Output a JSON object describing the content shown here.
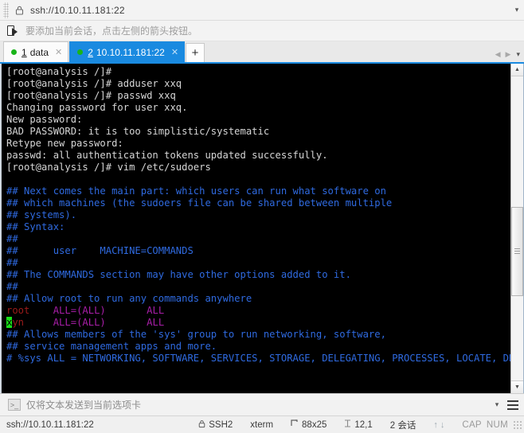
{
  "window": {
    "url_bar": {
      "lock_icon": "lock-icon",
      "value": "ssh://10.10.11.181:22",
      "dropdown_icon": "▾"
    },
    "hint_bar": {
      "icon": "add-session-icon",
      "text": "要添加当前会话，点击左侧的箭头按钮。"
    }
  },
  "tabs": {
    "items": [
      {
        "num": "1",
        "label": "data",
        "close": "✕",
        "active": false
      },
      {
        "num": "2",
        "label": "10.10.11.181:22",
        "close": "✕",
        "active": true
      }
    ],
    "new_tab_label": "+",
    "nav_prev": "◀",
    "nav_next": "▶",
    "list_caret": "▾"
  },
  "terminal": {
    "lines": [
      {
        "segments": [
          {
            "text": "[root@analysis /]#",
            "color": "white"
          }
        ]
      },
      {
        "segments": [
          {
            "text": "[root@analysis /]# adduser xxq",
            "color": "white"
          }
        ]
      },
      {
        "segments": [
          {
            "text": "[root@analysis /]# passwd xxq",
            "color": "white"
          }
        ]
      },
      {
        "segments": [
          {
            "text": "Changing password for user xxq.",
            "color": "white"
          }
        ]
      },
      {
        "segments": [
          {
            "text": "New password:",
            "color": "white"
          }
        ]
      },
      {
        "segments": [
          {
            "text": "BAD PASSWORD: it is too simplistic/systematic",
            "color": "white"
          }
        ]
      },
      {
        "segments": [
          {
            "text": "Retype new password:",
            "color": "white"
          }
        ]
      },
      {
        "segments": [
          {
            "text": "passwd: all authentication tokens updated successfully.",
            "color": "white"
          }
        ]
      },
      {
        "segments": [
          {
            "text": "[root@analysis /]# vim /etc/sudoers",
            "color": "white"
          }
        ]
      },
      {
        "segments": [
          {
            "text": "",
            "color": "white"
          }
        ]
      },
      {
        "segments": [
          {
            "text": "## Next comes the main part: which users can run what software on",
            "color": "blue"
          }
        ]
      },
      {
        "segments": [
          {
            "text": "## which machines (the sudoers file can be shared between multiple",
            "color": "blue"
          }
        ]
      },
      {
        "segments": [
          {
            "text": "## systems).",
            "color": "blue"
          }
        ]
      },
      {
        "segments": [
          {
            "text": "## Syntax:",
            "color": "blue"
          }
        ]
      },
      {
        "segments": [
          {
            "text": "##",
            "color": "blue"
          }
        ]
      },
      {
        "segments": [
          {
            "text": "##      user    MACHINE=COMMANDS",
            "color": "blue"
          }
        ]
      },
      {
        "segments": [
          {
            "text": "##",
            "color": "blue"
          }
        ]
      },
      {
        "segments": [
          {
            "text": "## The COMMANDS section may have other options added to it.",
            "color": "blue"
          }
        ]
      },
      {
        "segments": [
          {
            "text": "##",
            "color": "blue"
          }
        ]
      },
      {
        "segments": [
          {
            "text": "## Allow root to run any commands anywhere",
            "color": "blue"
          }
        ]
      },
      {
        "segments": [
          {
            "text": "root",
            "color": "red"
          },
          {
            "text": "    ",
            "color": "white"
          },
          {
            "text": "ALL=(ALL)",
            "color": "magenta"
          },
          {
            "text": "       ",
            "color": "white"
          },
          {
            "text": "ALL",
            "color": "magenta"
          }
        ]
      },
      {
        "segments": [
          {
            "text": "x",
            "color": "cursor"
          },
          {
            "text": "yn",
            "color": "red"
          },
          {
            "text": "     ",
            "color": "white"
          },
          {
            "text": "ALL=(ALL)",
            "color": "magenta"
          },
          {
            "text": "       ",
            "color": "white"
          },
          {
            "text": "ALL",
            "color": "magenta"
          }
        ]
      },
      {
        "segments": [
          {
            "text": "## Allows members of the 'sys' group to run networking, software,",
            "color": "blue"
          }
        ]
      },
      {
        "segments": [
          {
            "text": "## service management apps and more.",
            "color": "blue"
          }
        ]
      },
      {
        "segments": [
          {
            "text": "# %sys ALL = NETWORKING, SOFTWARE, SERVICES, STORAGE, DELEGATING, PROCESSES, LOCATE, DRI",
            "color": "blue"
          }
        ]
      }
    ],
    "scrollbar": {
      "up": "▲",
      "down": "▼"
    }
  },
  "send_bar": {
    "icon": ">_",
    "text": "仅将文本发送到当前选项卡",
    "caret": "▾",
    "menu_icon": "hamburger-menu-icon"
  },
  "status_bar": {
    "host": "ssh://10.10.11.181:22",
    "protocol": "SSH2",
    "terminal_type": "xterm",
    "size": "88x25",
    "cursor_pos": "12,1",
    "sessions": "2 会话",
    "upload_icon": "↑",
    "download_icon": "↓",
    "caps": "CAP",
    "num": "NUM"
  },
  "colors": {
    "accent": "#1a8ae0",
    "terminal_bg": "#000000",
    "comment_blue": "#2f6ae0",
    "user_red": "#9e1b1b",
    "rule_magenta": "#a81ea8",
    "cursor_green": "#19e019"
  }
}
